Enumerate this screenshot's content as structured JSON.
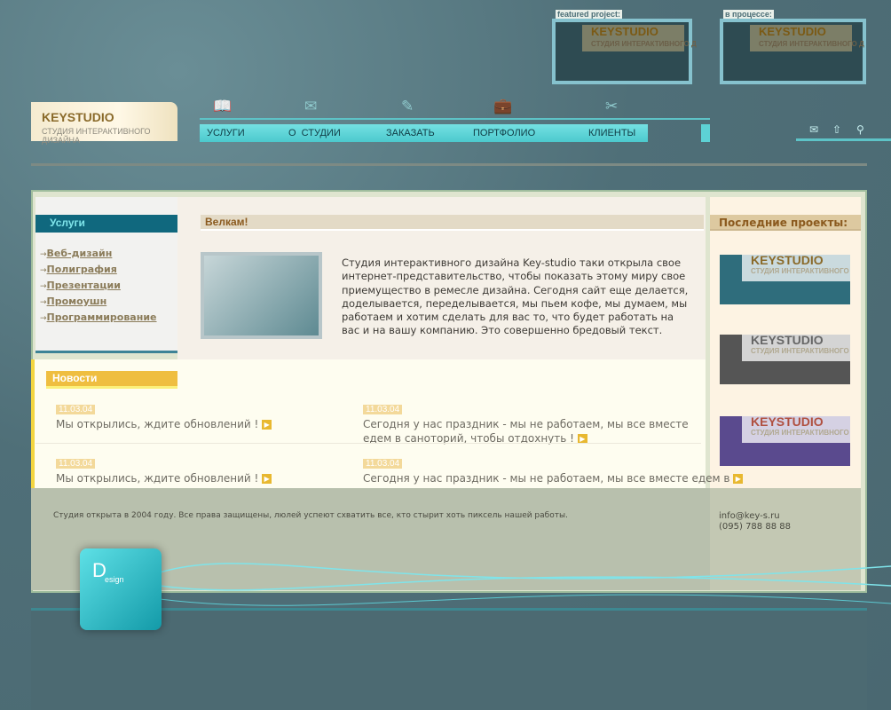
{
  "logo": {
    "title": "KEYSTUDIO",
    "subtitle": "СТУДИЯ ИНТЕРАКТИВНОГО ДИЗАЙНА"
  },
  "nav": {
    "items": [
      {
        "label": "УСЛУГИ",
        "icon": "book-icon"
      },
      {
        "label": "О  СТУДИИ",
        "icon": "card-icon"
      },
      {
        "label": "ЗАКАЗАТЬ",
        "icon": "brush-icon"
      },
      {
        "label": "ПОРТФОЛИО",
        "icon": "briefcase-icon"
      },
      {
        "label": "КЛИЕНТЫ",
        "icon": "tools-icon"
      }
    ]
  },
  "utility_icons": [
    "mail-icon",
    "home-icon",
    "search-icon"
  ],
  "featured": {
    "label": "featured project:",
    "logo": "KEYSTUDIO",
    "sub": "СТУДИЯ ИНТЕРАКТИВНОГО Д"
  },
  "in_progress": {
    "label": "в процессе:",
    "logo": "KEYSTUDIO",
    "sub": "СТУДИЯ ИНТЕРАКТИВНОГО Д"
  },
  "services": {
    "title": "Услуги",
    "items": [
      "Веб-дизайн",
      "Полиграфия",
      "Презентации",
      "Промоушн",
      "Программирование"
    ]
  },
  "welcome": {
    "title": "Велкам!",
    "text": "Студия интерактивного дизайна Key-studio таки открыла свое интернет-представительство, чтобы показать этому миру свое приемущество в ремесле дизайна. Сегодня сайт еще делается, доделывается, переделывается, мы пьем кофе, мы думаем, мы работаем и хотим сделать для вас то, что будет работать на вас и на вашу компанию. Это совершенно бредовый текст."
  },
  "recent": {
    "title": "Последние проекты:",
    "projects": [
      {
        "logo": "KEYSTUDIO",
        "sub": "СТУДИЯ ИНТЕРАКТИВНОГО Д",
        "color": "#2f6d7c",
        "logo_color": "#8a6a2a"
      },
      {
        "logo": "KEYSTUDIO",
        "sub": "СТУДИЯ ИНТЕРАКТИВНОГО Д",
        "color": "#555555",
        "logo_color": "#666666"
      },
      {
        "logo": "KEYSTUDIO",
        "sub": "СТУДИЯ ИНТЕРАКТИВНОГО Д",
        "color": "#5a4a8e",
        "logo_color": "#b05040"
      }
    ]
  },
  "news": {
    "title": "Новости",
    "items": [
      {
        "date": "11.03.04",
        "text": "Мы открылись, ждите обновлений !"
      },
      {
        "date": "11.03.04",
        "text": "Сегодня у нас праздник - мы не работаем, мы все вместе едем в санoторий, чтобы отдохнуть !"
      },
      {
        "date": "11.03.04",
        "text": "Мы открылись, ждите обновлений !"
      },
      {
        "date": "11.03.04",
        "text": "Сегодня у нас праздник - мы не работаем, мы все вместе едем в"
      }
    ]
  },
  "footer": {
    "copyright": "Студия открыта в 2004 году. Все права защищены, люлей успеют схватить все, кто стырит хоть пиксель нашей работы.",
    "email": "info@key-s.ru",
    "phone": "(095) 788 88 88"
  },
  "key": {
    "letter": "D",
    "rest": "esign"
  }
}
